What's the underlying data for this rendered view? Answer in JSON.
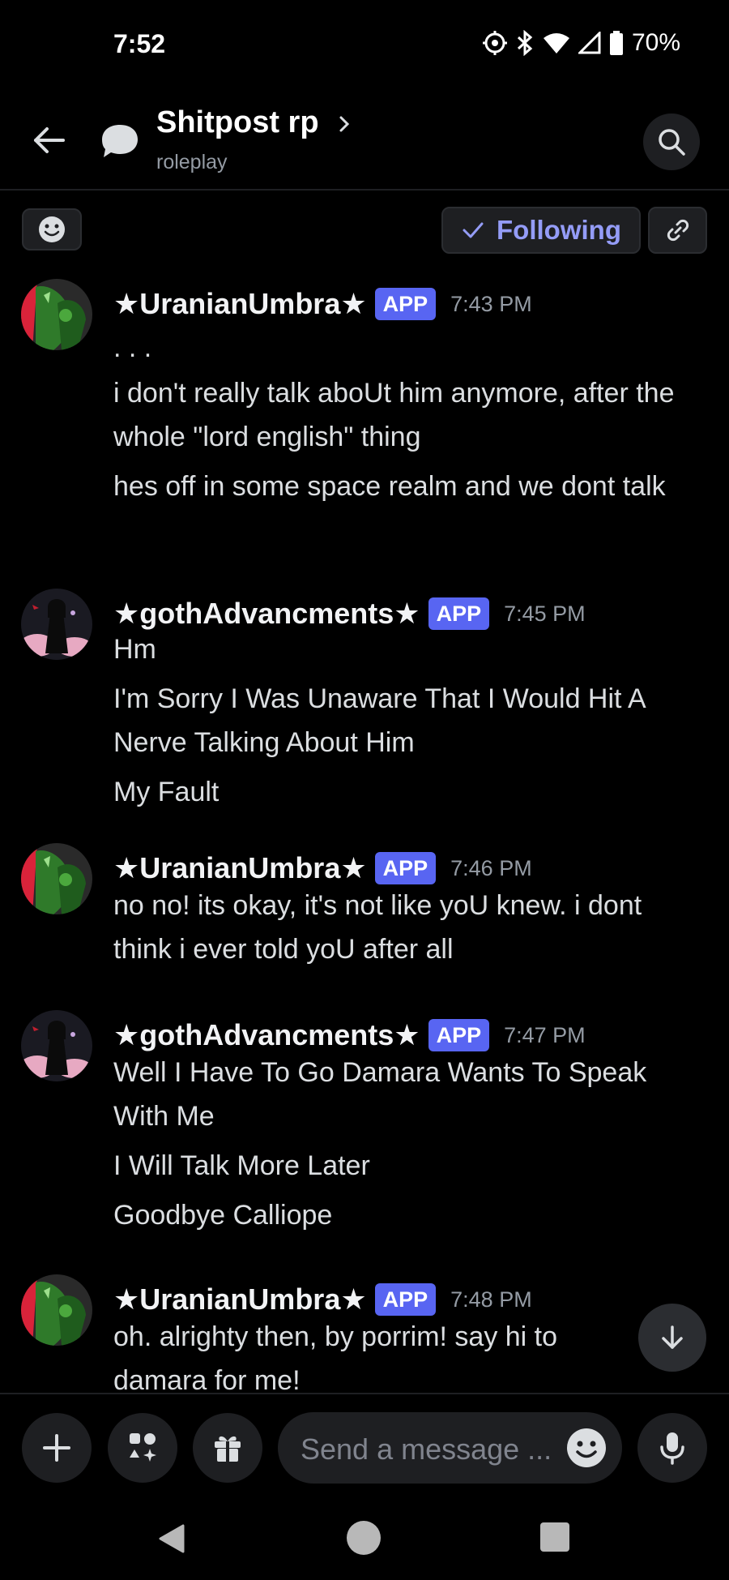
{
  "status_bar": {
    "time": "7:52",
    "battery": "70%"
  },
  "header": {
    "title": "Shitpost rp",
    "subtitle": "roleplay"
  },
  "actions": {
    "following_label": "Following"
  },
  "messages": [
    {
      "author": "★UranianUmbra★",
      "badge": "APP",
      "time": "7:43 PM",
      "lines": [
        ". . .",
        "i don't really talk aboUt him anymore, after the whole \"lord english\" thing",
        "hes off in some space realm and we dont talk"
      ]
    },
    {
      "author": "★gothAdvancments★",
      "badge": "APP",
      "time": "7:45 PM",
      "lines": [
        "Hm",
        "I'm Sorry I Was Unaware That I Would Hit A Nerve Talking About Him",
        "My Fault"
      ]
    },
    {
      "author": "★UranianUmbra★",
      "badge": "APP",
      "time": "7:46 PM",
      "lines": [
        "no no! its okay, it's not like yoU knew. i dont think i ever told yoU after all"
      ]
    },
    {
      "author": "★gothAdvancments★",
      "badge": "APP",
      "time": "7:47 PM",
      "lines": [
        "Well I Have To Go Damara Wants To Speak With Me",
        "I Will Talk More Later",
        "Goodbye Calliope"
      ]
    },
    {
      "author": "★UranianUmbra★",
      "badge": "APP",
      "time": "7:48 PM",
      "lines": [
        "oh. alrighty then, by porrim! say hi to damara for me!"
      ]
    }
  ],
  "composer": {
    "placeholder": "Send a message ..."
  },
  "colors": {
    "accent": "#5865f2",
    "following_text": "#949cf7",
    "background": "#000000"
  }
}
